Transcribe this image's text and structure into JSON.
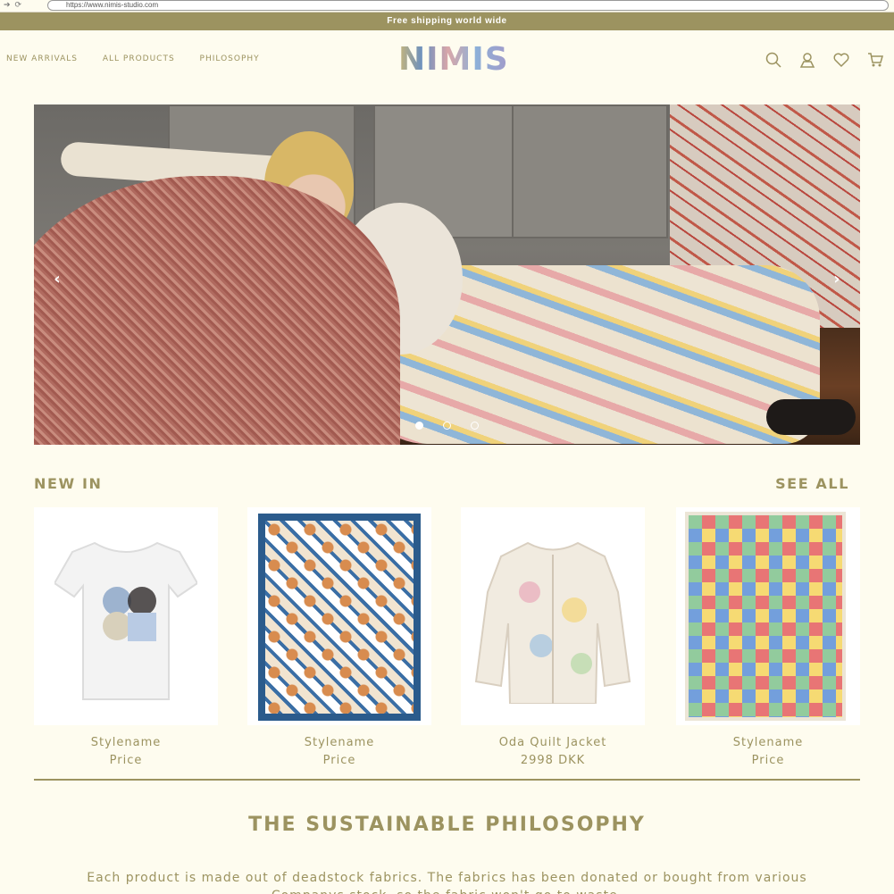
{
  "browser": {
    "url": "https://www.nimis-studio.com"
  },
  "banner": {
    "text": "Free shipping world wide"
  },
  "nav": {
    "items": [
      {
        "label": "NEW ARRIVALS"
      },
      {
        "label": "ALL PRODUCTS"
      },
      {
        "label": "PHILOSOPHY"
      }
    ],
    "logo": "NIMIS"
  },
  "icons": [
    "search-icon",
    "account-icon",
    "wishlist-icon",
    "cart-icon"
  ],
  "hero": {
    "arrow_left": "‹",
    "arrow_right": "›",
    "slides": 3,
    "active_slide": 1
  },
  "new_in": {
    "title": "NEW IN",
    "see_all": "SEE ALL",
    "products": [
      {
        "name": "Stylename",
        "price": "Price"
      },
      {
        "name": "Stylename",
        "price": "Price"
      },
      {
        "name": "Oda Quilt Jacket",
        "price": "2998 DKK"
      },
      {
        "name": "Stylename",
        "price": "Price"
      }
    ]
  },
  "philosophy": {
    "title": "THE SUSTAINABLE PHILOSOPHY",
    "text": "Each product is made out of deadstock fabrics. The fabrics has been donated or bought from various Companys stock, so the fabric won't go to waste."
  },
  "colors": {
    "accent": "#9c9360",
    "background": "#fefcef"
  }
}
